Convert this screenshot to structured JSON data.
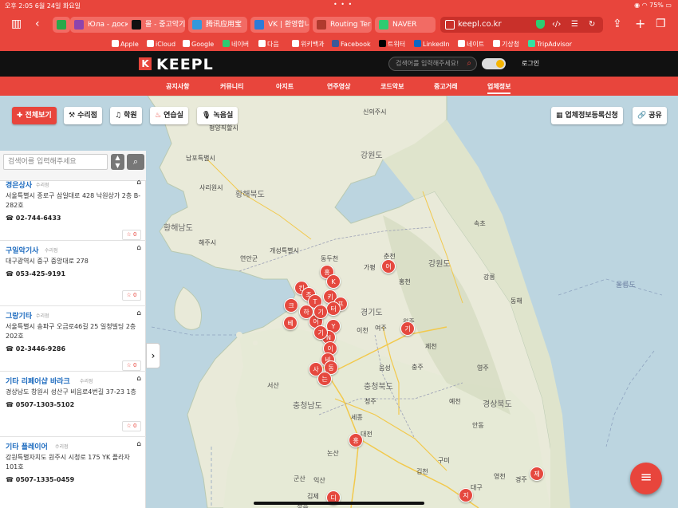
{
  "status": {
    "time_date": "오후 2:05   6월 24일 화요일",
    "dots": "• • •",
    "battery": "75%"
  },
  "browser": {
    "tabs": [
      {
        "label": "",
        "fav": "#2aa84a"
      },
      {
        "label": "Юла - доск",
        "fav": "#8e44ad"
      },
      {
        "label": "몰 - 중고악기",
        "fav": "#111111"
      },
      {
        "label": "腾讯应用宝",
        "fav": "#3498db"
      },
      {
        "label": "VK | 환영합니",
        "fav": "#2e7bd6"
      },
      {
        "label": "Routing Ter",
        "fav": "#b03a2e"
      },
      {
        "label": "NAVER",
        "fav": "#2ecc71"
      }
    ],
    "url": "keepl.co.kr"
  },
  "bookmarks": [
    {
      "label": "Apple",
      "color": "#ffffff"
    },
    {
      "label": "iCloud",
      "color": "#ffffff"
    },
    {
      "label": "Google",
      "color": "#ffffff"
    },
    {
      "label": "네이버",
      "color": "#2ecc71"
    },
    {
      "label": "다음",
      "color": "#ffffff"
    },
    {
      "label": "위키백과",
      "color": "#ffffff"
    },
    {
      "label": "Facebook",
      "color": "#3b5998"
    },
    {
      "label": "트위터",
      "color": "#000000"
    },
    {
      "label": "LinkedIn",
      "color": "#0a66c2"
    },
    {
      "label": "네이트",
      "color": "#ffffff"
    },
    {
      "label": "기상청",
      "color": "#ffffff"
    },
    {
      "label": "TripAdvisor",
      "color": "#34e0a1"
    }
  ],
  "site": {
    "logo_letter": "K",
    "logo_text": "KEEPL",
    "search_placeholder": "검색어를 입력해주세요!",
    "login": "로그인",
    "nav": [
      "공지사항",
      "커뮤니티",
      "아지트",
      "연주영상",
      "코드악보",
      "중고거래",
      "업체정보"
    ],
    "nav_active": "업체정보",
    "accent": "#e8453c"
  },
  "filters": {
    "all": "전체보기",
    "repair": "수리점",
    "academy": "학원",
    "practice": "연습실",
    "recording": "녹음실",
    "register": "업체정보등록신청",
    "share": "공유"
  },
  "panel": {
    "search_placeholder": "검색어를 입력해주세요",
    "items": [
      {
        "name": "경은상사",
        "category": "수리점",
        "address": "서울특별시 종로구 삼일대로 428 낙원상가 2층 B-282호",
        "phone": "02-744-6433",
        "rating": "☆ 0"
      },
      {
        "name": "구일악기사",
        "category": "수리점",
        "address": "대구광역시 중구 중앙대로 278",
        "phone": "053-425-9191",
        "rating": "☆ 0"
      },
      {
        "name": "그랑기타",
        "category": "수리점",
        "address": "서울특별시 송파구 오금로46길 25 일청빌딩 2층 202호",
        "phone": "02-3446-9286",
        "rating": "☆ 0"
      },
      {
        "name": "기타 리페어샵 바라크",
        "category": "수리점",
        "address": "경상남도 창원시 성산구 비음로4번길 37-23 1층",
        "phone": "0507-1303-5102",
        "rating": "☆ 0"
      },
      {
        "name": "기타 플레이어",
        "category": "수리점",
        "address": "강원특별자치도 원주시 시청로 175 YK 플라자 101호",
        "phone": "0507-1335-0459",
        "rating": ""
      }
    ]
  },
  "map": {
    "labels": {
      "sinuiju": "신의주시",
      "pyongyang": "평양직할시",
      "south_pyongan": "남포특별시",
      "gangwon_n": "강원도",
      "hwanghae_n": "황해북도",
      "hwanghae_s": "황해남도",
      "sariwon": "사리원시",
      "haeju": "해주시",
      "gaeseong": "개성특별시",
      "dongducheon": "동두천",
      "yeonan": "연안군",
      "gyeonggi": "경기도",
      "gangwon_s": "강원도",
      "chungbuk": "충청북도",
      "chungnam": "충청남도",
      "gyeongbuk": "경상북도",
      "sokcho": "속초",
      "chuncheon": "춘천",
      "wonju": "원주",
      "sejong": "세종",
      "daejeon": "대전",
      "gumi": "구미",
      "daegu": "대구",
      "gyeongju": "경주",
      "gimcheon": "김천",
      "andong": "안동",
      "yecheon": "예천",
      "yeongju": "영주",
      "donghae": "동해",
      "gangneung": "강릉",
      "cheongju": "청주",
      "chungju": "충주",
      "gunsan": "군산",
      "iksan": "익산",
      "nonsan": "논산",
      "seosan": "서산",
      "hongcheon": "홍천",
      "gapyeong": "가평",
      "icheon": "이천",
      "yeoju": "여주",
      "jecheon": "제천",
      "eumseong": "음성",
      "gimje": "김제",
      "jeongeup": "정읍",
      "youngcheon": "영천",
      "ulleung_label": "울릉도"
    },
    "markers": [
      {
        "t": "어"
      },
      {
        "t": "홍"
      },
      {
        "t": "K"
      },
      {
        "t": "킨"
      },
      {
        "t": "키"
      },
      {
        "t": "조"
      },
      {
        "t": "T"
      },
      {
        "t": "프"
      },
      {
        "t": "크"
      },
      {
        "t": "하"
      },
      {
        "t": "터"
      },
      {
        "t": "베"
      },
      {
        "t": "어"
      },
      {
        "t": "Y"
      },
      {
        "t": "기"
      },
      {
        "t": "N"
      },
      {
        "t": "이"
      },
      {
        "t": "기"
      },
      {
        "t": "비"
      },
      {
        "t": "사"
      },
      {
        "t": "동"
      },
      {
        "t": "는"
      },
      {
        "t": "기"
      },
      {
        "t": "홍"
      },
      {
        "t": "제"
      },
      {
        "t": "지"
      },
      {
        "t": "디"
      }
    ]
  }
}
